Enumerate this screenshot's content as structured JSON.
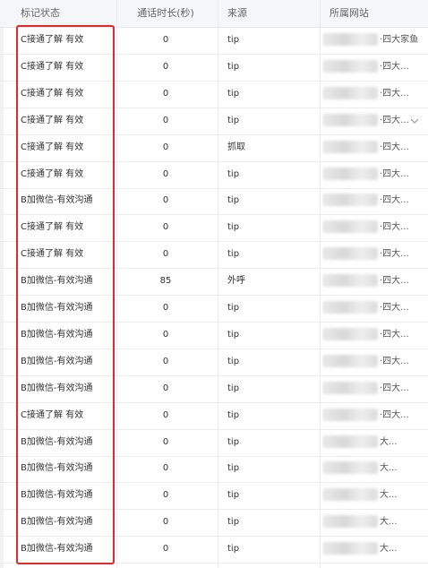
{
  "headers": {
    "status": "标记状态",
    "duration": "通话时长(秒)",
    "source": "来源",
    "site": "所属网站"
  },
  "rows": [
    {
      "status": "C接通了解 有效",
      "duration": "0",
      "source": "tip",
      "site": "·四大家鱼"
    },
    {
      "status": "C接通了解 有效",
      "duration": "0",
      "source": "tip",
      "site": "·四大..."
    },
    {
      "status": "C接通了解 有效",
      "duration": "0",
      "source": "tip",
      "site": "·四大..."
    },
    {
      "status": "C接通了解 有效",
      "duration": "0",
      "source": "tip",
      "site": "·四大..."
    },
    {
      "status": "C接通了解 有效",
      "duration": "0",
      "source": "抓取",
      "site": "·四大..."
    },
    {
      "status": "C接通了解 有效",
      "duration": "0",
      "source": "tip",
      "site": "·四大..."
    },
    {
      "status": "B加微信-有效沟通",
      "duration": "0",
      "source": "tip",
      "site": "·四大..."
    },
    {
      "status": "C接通了解 有效",
      "duration": "0",
      "source": "tip",
      "site": "·四大..."
    },
    {
      "status": "C接通了解 有效",
      "duration": "0",
      "source": "tip",
      "site": "·四大..."
    },
    {
      "status": "B加微信-有效沟通",
      "duration": "85",
      "source": "外呼",
      "site": "·四大..."
    },
    {
      "status": "B加微信-有效沟通",
      "duration": "0",
      "source": "tip",
      "site": "·四大..."
    },
    {
      "status": "B加微信-有效沟通",
      "duration": "0",
      "source": "tip",
      "site": "·四大..."
    },
    {
      "status": "B加微信-有效沟通",
      "duration": "0",
      "source": "tip",
      "site": "·四大..."
    },
    {
      "status": "B加微信-有效沟通",
      "duration": "0",
      "source": "tip",
      "site": "·四大..."
    },
    {
      "status": "C接通了解 有效",
      "duration": "0",
      "source": "tip",
      "site": "·四大..."
    },
    {
      "status": "B加微信-有效沟通",
      "duration": "0",
      "source": "tip",
      "site": "大..."
    },
    {
      "status": "B加微信-有效沟通",
      "duration": "0",
      "source": "tip",
      "site": "大..."
    },
    {
      "status": "B加微信-有效沟通",
      "duration": "0",
      "source": "tip",
      "site": "大..."
    },
    {
      "status": "B加微信-有效沟通",
      "duration": "0",
      "source": "tip",
      "site": "大..."
    },
    {
      "status": "B加微信-有效沟通",
      "duration": "0",
      "source": "tip",
      "site": "大..."
    }
  ],
  "colors": {
    "highlight": "#e02b2b",
    "header_bg": "#f5f6f8"
  },
  "icons": {
    "expand": "chevron-down-icon"
  }
}
